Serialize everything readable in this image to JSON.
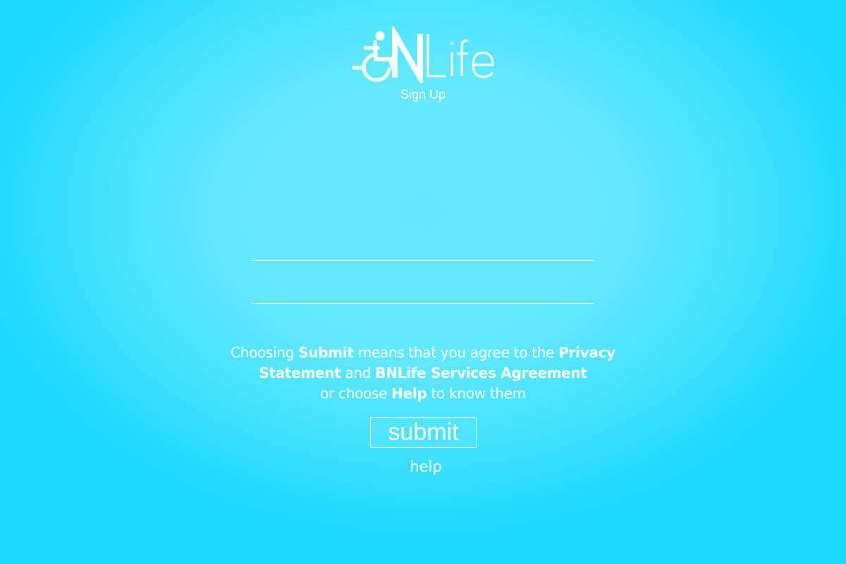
{
  "brand": {
    "logo_text": "BNLife",
    "accent_color": "#ffffff",
    "background_color": "#62e8ff",
    "edge_color": "#1cd8fe"
  },
  "page": {
    "subtitle": "Sign Up"
  },
  "form": {
    "field_1_value": "",
    "field_2_value": ""
  },
  "agreement": {
    "part1": "Choosing ",
    "submit_word": "Submit",
    "part2": " means that you agree to the ",
    "privacy_statement": "Privacy Statement",
    "part3": " and ",
    "services_agreement": "BNLife Services Agreement",
    "part4": " or choose ",
    "help_word": "Help",
    "part5": " to know them"
  },
  "actions": {
    "submit_label": "submit",
    "help_label": "help"
  }
}
